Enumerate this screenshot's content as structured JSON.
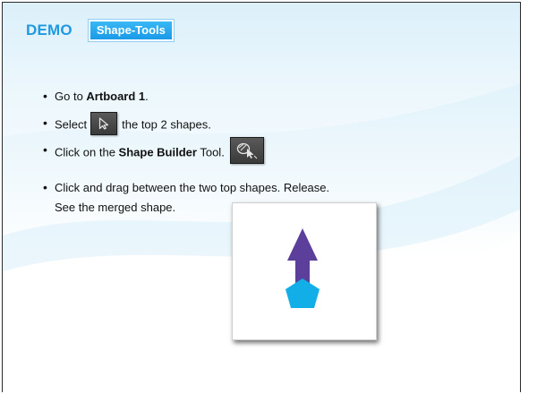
{
  "header": {
    "demo_label": "DEMO",
    "badge_label": "Shape-Tools"
  },
  "steps": {
    "step1": {
      "pre": "Go to ",
      "bold": "Artboard 1",
      "post": "."
    },
    "step2": {
      "pre": "Select",
      "post": "the top 2 shapes."
    },
    "step3": {
      "pre": "Click on the ",
      "bold": "Shape Builder",
      "post": " Tool."
    },
    "step4": {
      "line1": "Click and drag between the two top shapes. Release.",
      "line2": "See the merged shape."
    }
  },
  "icons": {
    "select_tool": "selection-arrow-icon",
    "shape_builder_tool": "shape-builder-icon"
  },
  "colors": {
    "accent_blue": "#1f9ae0",
    "arrow_purple": "#5b3f9a",
    "pentagon_cyan": "#11aee8",
    "tool_button_gray": "#4a4a4a"
  }
}
